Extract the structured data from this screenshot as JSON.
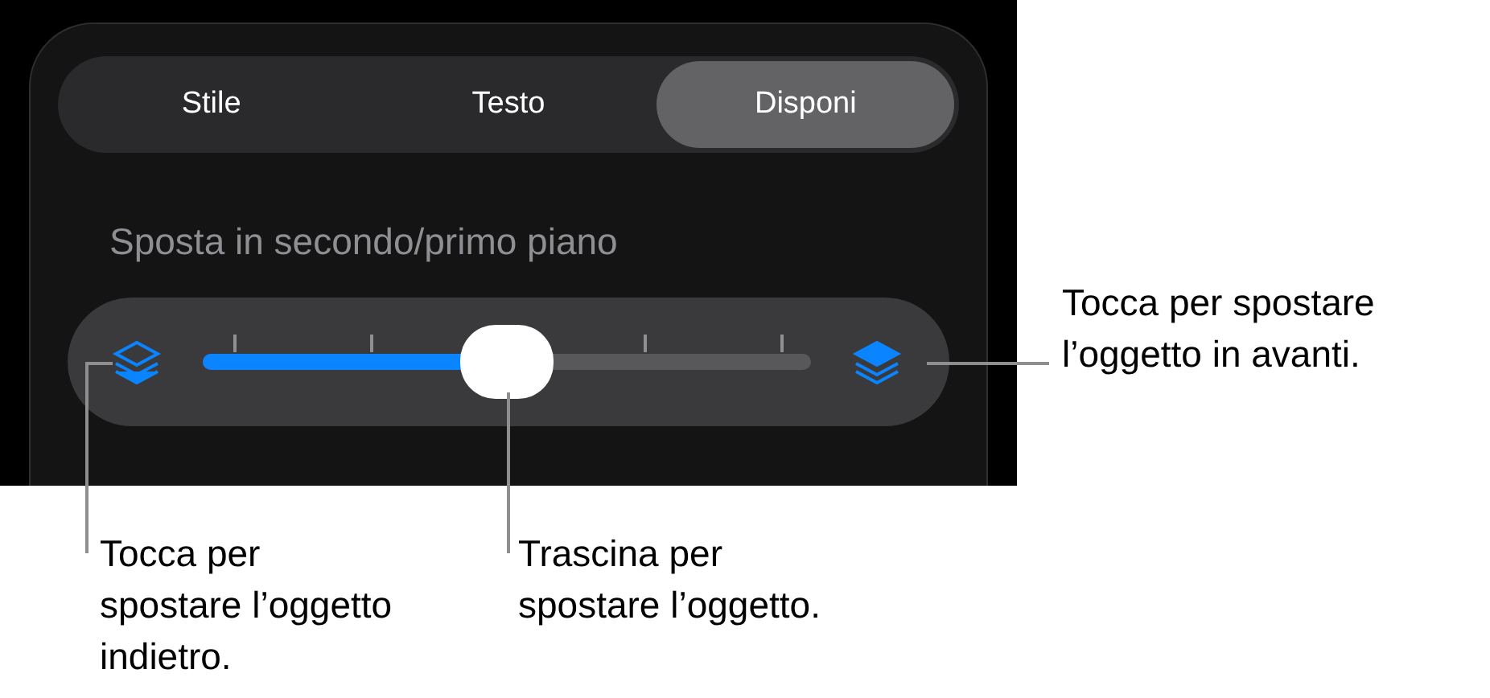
{
  "tabs": [
    {
      "label": "Stile",
      "selected": false
    },
    {
      "label": "Testo",
      "selected": false
    },
    {
      "label": "Disponi",
      "selected": true
    }
  ],
  "section_title": "Sposta in secondo/primo piano",
  "slider": {
    "level": 0.5
  },
  "callouts": [
    {
      "kind": "forward",
      "text": "Tocca per spostare\nl’oggetto in avanti."
    },
    {
      "kind": "backward",
      "text": "Tocca per\nspostare l’oggetto\nindietro."
    },
    {
      "kind": "thumb",
      "text": "Trascina per\nspostare l’oggetto."
    }
  ]
}
